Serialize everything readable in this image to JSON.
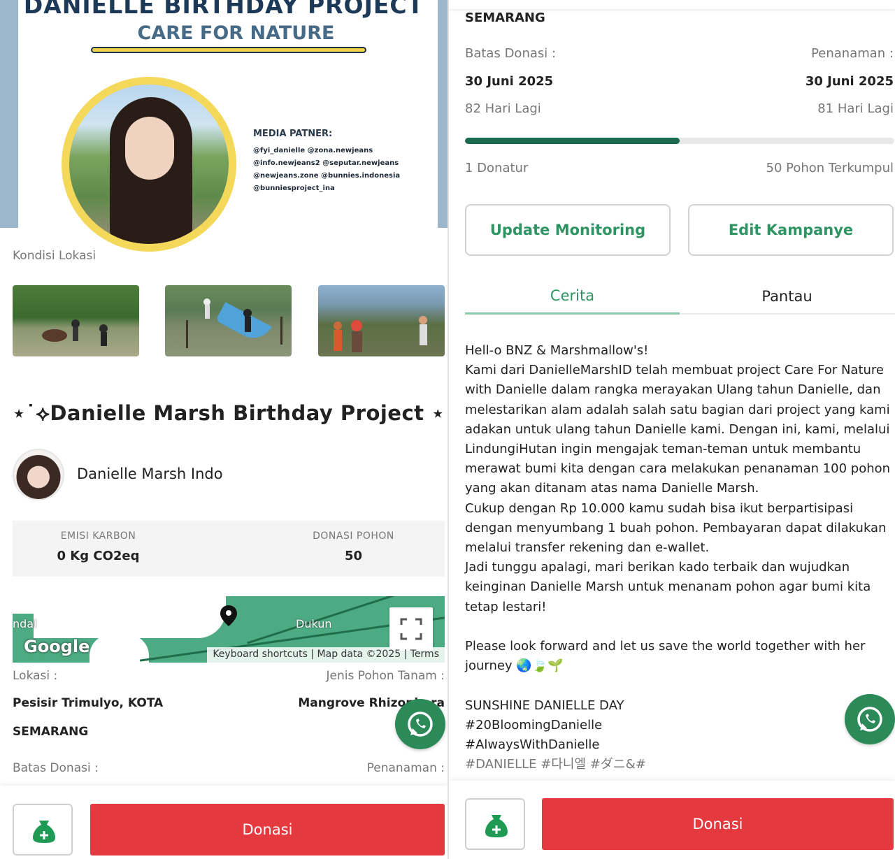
{
  "left": {
    "poster": {
      "title": "DANIELLE BIRTHDAY PROJECT",
      "subtitle": "CARE FOR NATURE",
      "media_heading": "MEDIA PATNER:",
      "media_lines": [
        "@fyi_danielle @zona.newjeans",
        "@info.newjeans2 @seputar.newjeans",
        "@newjeans.zone @bunnies.indonesia",
        "@bunniesproject_ina"
      ]
    },
    "kondisi_label": "Kondisi Lokasi",
    "project_title": "⋆˙⟡Danielle Marsh Birthday Project ⋆˙⟡",
    "owner_name": "Danielle Marsh Indo",
    "stats": {
      "emisi_label": "EMISI KARBON",
      "emisi_value": "0 Kg CO2eq",
      "pohon_label": "DONASI POHON",
      "pohon_value": "50"
    },
    "map": {
      "place_left": "ndal",
      "place_right": "Dukun",
      "google": "Google",
      "attribution": "Keyboard shortcuts  |  Map data ©2025  |  Terms"
    },
    "lokasi_label": "Lokasi :",
    "lokasi_value_1": "Pesisir Trimulyo, KOTA",
    "lokasi_value_2": "SEMARANG",
    "jenis_label": "Jenis Pohon Tanam :",
    "jenis_value": "Mangrove Rhizophora",
    "batas_label": "Batas Donasi :",
    "penanaman_label": "Penanaman :",
    "donasi_button": "Donasi"
  },
  "right": {
    "location_tail": "SEMARANG",
    "batas_label": "Batas Donasi :",
    "batas_date": "30 Juni 2025",
    "batas_remaining": "82 Hari Lagi",
    "penanaman_label": "Penanaman :",
    "penanaman_date": "30 Juni 2025",
    "penanaman_remaining": "81 Hari Lagi",
    "progress_fraction": 0.5,
    "donatur": "1 Donatur",
    "terkumpul": "50 Pohon Terkumpul",
    "update_button": "Update Monitoring",
    "edit_button": "Edit Kampanye",
    "tabs": [
      "Cerita",
      "Pantau"
    ],
    "story": [
      "Hell-o BNZ & Marshmallow's!",
      "Kami dari DanielleMarshID telah membuat project Care For Nature with Danielle dalam rangka merayakan Ulang tahun Danielle, dan melestarikan alam adalah salah satu bagian dari project yang kami adakan untuk ulang tahun Danielle kami. Dengan ini, kami, melalui LindungiHutan ingin mengajak teman-teman untuk membantu merawat bumi kita dengan cara melakukan penanaman 100 pohon yang akan ditanam atas nama Danielle Marsh.",
      "Cukup dengan Rp 10.000 kamu sudah bisa ikut berpartisipasi dengan menyumbang 1 buah pohon. Pembayaran dapat dilakukan melalui transfer rekening dan e-wallet.",
      "Jadi tunggu apalagi, mari berikan kado terbaik dan wujudkan keinginan Danielle Marsh untuk menanam pohon agar bumi kita tetap lestari!",
      "",
      "Please look forward and let us save the world together with her journey 🌏🍃🌱",
      "",
      "SUNSHINE DANIELLE DAY",
      "#20BloomingDanielle",
      "#AlwaysWithDanielle"
    ],
    "story_faded": "#DANIELLE #다니엘 #ダニ&#",
    "donasi_button": "Donasi"
  },
  "colors": {
    "green": "#2e9463",
    "dark_green": "#1c6a4e",
    "red": "#e3393f",
    "whatsapp": "#2c8a59"
  }
}
